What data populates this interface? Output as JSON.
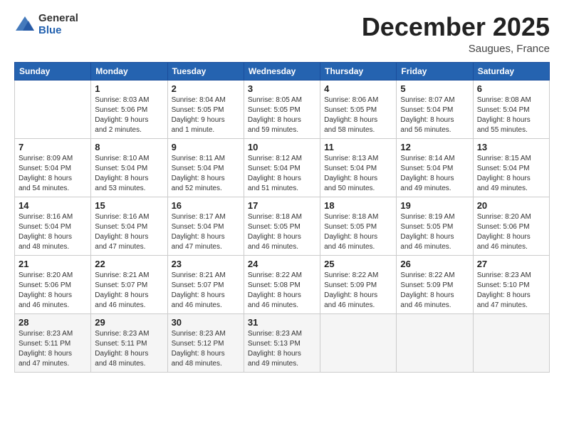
{
  "header": {
    "logo_general": "General",
    "logo_blue": "Blue",
    "month_title": "December 2025",
    "location": "Saugues, France"
  },
  "weekdays": [
    "Sunday",
    "Monday",
    "Tuesday",
    "Wednesday",
    "Thursday",
    "Friday",
    "Saturday"
  ],
  "weeks": [
    [
      {
        "day": "",
        "info": ""
      },
      {
        "day": "1",
        "info": "Sunrise: 8:03 AM\nSunset: 5:06 PM\nDaylight: 9 hours\nand 2 minutes."
      },
      {
        "day": "2",
        "info": "Sunrise: 8:04 AM\nSunset: 5:05 PM\nDaylight: 9 hours\nand 1 minute."
      },
      {
        "day": "3",
        "info": "Sunrise: 8:05 AM\nSunset: 5:05 PM\nDaylight: 8 hours\nand 59 minutes."
      },
      {
        "day": "4",
        "info": "Sunrise: 8:06 AM\nSunset: 5:05 PM\nDaylight: 8 hours\nand 58 minutes."
      },
      {
        "day": "5",
        "info": "Sunrise: 8:07 AM\nSunset: 5:04 PM\nDaylight: 8 hours\nand 56 minutes."
      },
      {
        "day": "6",
        "info": "Sunrise: 8:08 AM\nSunset: 5:04 PM\nDaylight: 8 hours\nand 55 minutes."
      }
    ],
    [
      {
        "day": "7",
        "info": "Sunrise: 8:09 AM\nSunset: 5:04 PM\nDaylight: 8 hours\nand 54 minutes."
      },
      {
        "day": "8",
        "info": "Sunrise: 8:10 AM\nSunset: 5:04 PM\nDaylight: 8 hours\nand 53 minutes."
      },
      {
        "day": "9",
        "info": "Sunrise: 8:11 AM\nSunset: 5:04 PM\nDaylight: 8 hours\nand 52 minutes."
      },
      {
        "day": "10",
        "info": "Sunrise: 8:12 AM\nSunset: 5:04 PM\nDaylight: 8 hours\nand 51 minutes."
      },
      {
        "day": "11",
        "info": "Sunrise: 8:13 AM\nSunset: 5:04 PM\nDaylight: 8 hours\nand 50 minutes."
      },
      {
        "day": "12",
        "info": "Sunrise: 8:14 AM\nSunset: 5:04 PM\nDaylight: 8 hours\nand 49 minutes."
      },
      {
        "day": "13",
        "info": "Sunrise: 8:15 AM\nSunset: 5:04 PM\nDaylight: 8 hours\nand 49 minutes."
      }
    ],
    [
      {
        "day": "14",
        "info": "Sunrise: 8:16 AM\nSunset: 5:04 PM\nDaylight: 8 hours\nand 48 minutes."
      },
      {
        "day": "15",
        "info": "Sunrise: 8:16 AM\nSunset: 5:04 PM\nDaylight: 8 hours\nand 47 minutes."
      },
      {
        "day": "16",
        "info": "Sunrise: 8:17 AM\nSunset: 5:04 PM\nDaylight: 8 hours\nand 47 minutes."
      },
      {
        "day": "17",
        "info": "Sunrise: 8:18 AM\nSunset: 5:05 PM\nDaylight: 8 hours\nand 46 minutes."
      },
      {
        "day": "18",
        "info": "Sunrise: 8:18 AM\nSunset: 5:05 PM\nDaylight: 8 hours\nand 46 minutes."
      },
      {
        "day": "19",
        "info": "Sunrise: 8:19 AM\nSunset: 5:05 PM\nDaylight: 8 hours\nand 46 minutes."
      },
      {
        "day": "20",
        "info": "Sunrise: 8:20 AM\nSunset: 5:06 PM\nDaylight: 8 hours\nand 46 minutes."
      }
    ],
    [
      {
        "day": "21",
        "info": "Sunrise: 8:20 AM\nSunset: 5:06 PM\nDaylight: 8 hours\nand 46 minutes."
      },
      {
        "day": "22",
        "info": "Sunrise: 8:21 AM\nSunset: 5:07 PM\nDaylight: 8 hours\nand 46 minutes."
      },
      {
        "day": "23",
        "info": "Sunrise: 8:21 AM\nSunset: 5:07 PM\nDaylight: 8 hours\nand 46 minutes."
      },
      {
        "day": "24",
        "info": "Sunrise: 8:22 AM\nSunset: 5:08 PM\nDaylight: 8 hours\nand 46 minutes."
      },
      {
        "day": "25",
        "info": "Sunrise: 8:22 AM\nSunset: 5:09 PM\nDaylight: 8 hours\nand 46 minutes."
      },
      {
        "day": "26",
        "info": "Sunrise: 8:22 AM\nSunset: 5:09 PM\nDaylight: 8 hours\nand 46 minutes."
      },
      {
        "day": "27",
        "info": "Sunrise: 8:23 AM\nSunset: 5:10 PM\nDaylight: 8 hours\nand 47 minutes."
      }
    ],
    [
      {
        "day": "28",
        "info": "Sunrise: 8:23 AM\nSunset: 5:11 PM\nDaylight: 8 hours\nand 47 minutes."
      },
      {
        "day": "29",
        "info": "Sunrise: 8:23 AM\nSunset: 5:11 PM\nDaylight: 8 hours\nand 48 minutes."
      },
      {
        "day": "30",
        "info": "Sunrise: 8:23 AM\nSunset: 5:12 PM\nDaylight: 8 hours\nand 48 minutes."
      },
      {
        "day": "31",
        "info": "Sunrise: 8:23 AM\nSunset: 5:13 PM\nDaylight: 8 hours\nand 49 minutes."
      },
      {
        "day": "",
        "info": ""
      },
      {
        "day": "",
        "info": ""
      },
      {
        "day": "",
        "info": ""
      }
    ]
  ]
}
